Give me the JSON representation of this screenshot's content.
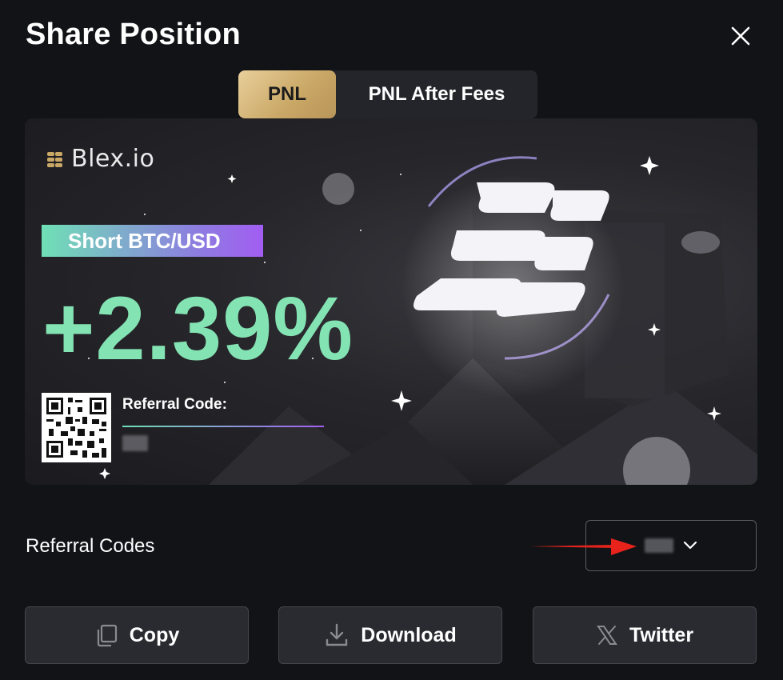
{
  "dialog": {
    "title": "Share Position"
  },
  "tabs": [
    {
      "label": "PNL",
      "active": true
    },
    {
      "label": "PNL After Fees",
      "active": false
    }
  ],
  "card": {
    "brand": "Blex.io",
    "position_badge": "Short BTC/USD",
    "pnl_value": "+2.39%",
    "referral_label": "Referral Code:",
    "referral_value": "(obscured)",
    "accent_green": "#84e3b3",
    "accent_purple": "#a25df2"
  },
  "referral_codes": {
    "label": "Referral Codes",
    "selected_value": "(obscured)"
  },
  "actions": {
    "copy_label": "Copy",
    "download_label": "Download",
    "twitter_label": "Twitter"
  },
  "colors": {
    "background": "#121317",
    "button_bg": "#2a2b31",
    "tab_active_gold": "#c9a765",
    "annotation_arrow": "#e8231c"
  },
  "icons": [
    "close-icon",
    "copy-icon",
    "download-icon",
    "x-twitter-icon",
    "chevron-down-icon",
    "blex-logo-icon",
    "qr-code"
  ]
}
